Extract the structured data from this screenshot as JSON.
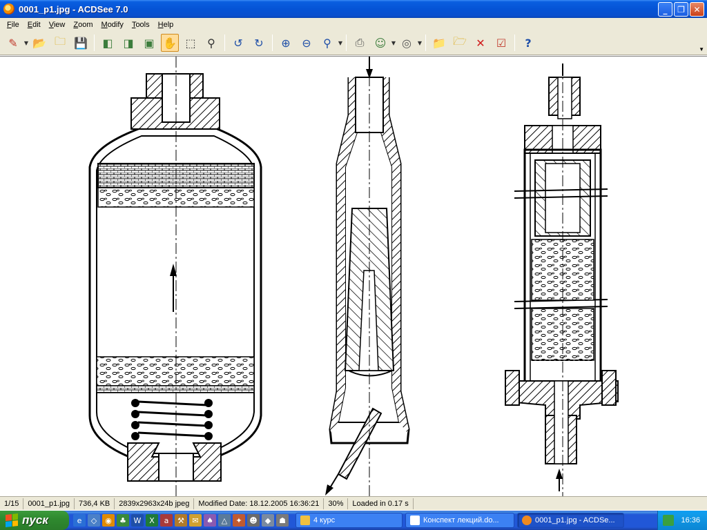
{
  "window": {
    "title": "0001_p1.jpg - ACDSee 7.0",
    "controls": [
      "minimize",
      "maximize",
      "close"
    ]
  },
  "menu": [
    "File",
    "Edit",
    "View",
    "Zoom",
    "Modify",
    "Tools",
    "Help"
  ],
  "toolbar": {
    "icons": [
      "acquire-icon",
      "open-folder-icon",
      "browse-icon",
      "save-icon",
      "previous-image-icon",
      "next-image-icon",
      "image-swap-icon",
      "hand-tool-icon",
      "select-tool-icon",
      "zoom-tool-icon",
      "rotate-left-icon",
      "rotate-right-icon",
      "zoom-in-icon",
      "zoom-out-icon",
      "zoom-fit-icon",
      "print-icon",
      "wallpaper-icon",
      "slideshow-icon",
      "copy-to-icon",
      "move-to-icon",
      "delete-icon",
      "properties-icon",
      "help-icon"
    ],
    "active": "hand-tool-icon"
  },
  "status": {
    "index": "1/15",
    "filename": "0001_p1.jpg",
    "filesize": "736,4 KB",
    "dimensions": "2839x2963x24b jpeg",
    "modified": "Modified Date: 18.12.2005 16:36:21",
    "zoom": "30%",
    "loaded": "Loaded in 0.17 s"
  },
  "taskbar": {
    "start_label": "пуск",
    "tasks": [
      {
        "label": "4 курс",
        "icon": "folder-icon"
      },
      {
        "label": "Конспект лекций.do...",
        "icon": "word-icon"
      },
      {
        "label": "0001_p1.jpg - ACDSe...",
        "icon": "acdsee-icon"
      }
    ],
    "clock": "16:36"
  },
  "colors": {
    "title_blue": "#0553d6",
    "chrome": "#ece9d8",
    "start_green": "#2f8a2f",
    "tray_blue": "#129bea"
  }
}
